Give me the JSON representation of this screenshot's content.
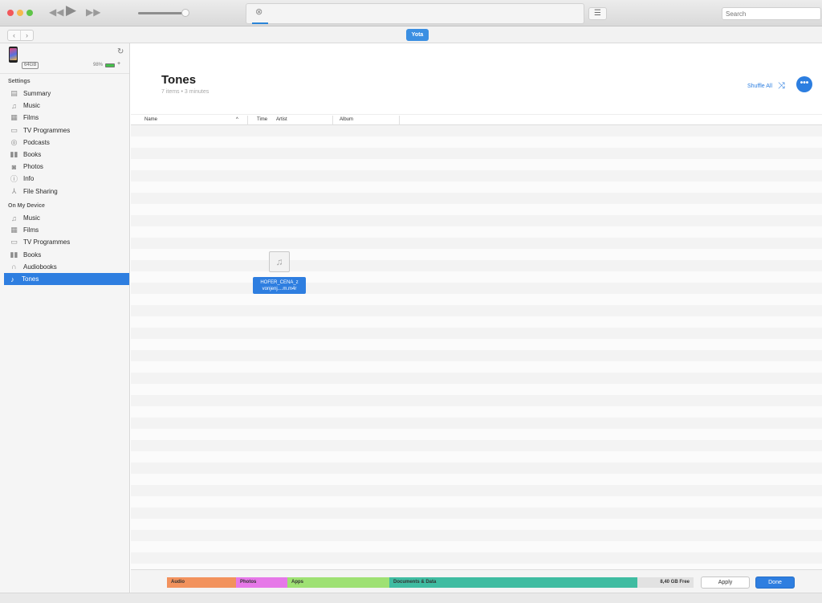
{
  "toolbar": {
    "search_placeholder": "Search",
    "lcd_icon": "close-circle-icon",
    "list_icon": "list-icon"
  },
  "navbar": {
    "back": "‹",
    "forward": "›",
    "device_name": "Yota"
  },
  "device": {
    "capacity": "64GB",
    "battery": "98%",
    "battery_level": 0.98
  },
  "sidebar": {
    "settings_title": "Settings",
    "settings_items": [
      {
        "label": "Summary",
        "icon": "summary-icon"
      },
      {
        "label": "Music",
        "icon": "music-note-icon"
      },
      {
        "label": "Films",
        "icon": "film-icon"
      },
      {
        "label": "TV Programmes",
        "icon": "tv-icon"
      },
      {
        "label": "Podcasts",
        "icon": "podcast-icon"
      },
      {
        "label": "Books",
        "icon": "books-icon"
      },
      {
        "label": "Photos",
        "icon": "camera-icon"
      },
      {
        "label": "Info",
        "icon": "info-icon"
      },
      {
        "label": "File Sharing",
        "icon": "file-sharing-icon"
      }
    ],
    "device_title": "On My Device",
    "device_items": [
      {
        "label": "Music",
        "icon": "music-note-icon"
      },
      {
        "label": "Films",
        "icon": "film-icon"
      },
      {
        "label": "TV Programmes",
        "icon": "tv-icon"
      },
      {
        "label": "Books",
        "icon": "books-icon"
      },
      {
        "label": "Audiobooks",
        "icon": "headphones-icon"
      },
      {
        "label": "Tones",
        "icon": "bell-icon",
        "active": true
      }
    ]
  },
  "main": {
    "title": "Tones",
    "subtitle": "7 items • 3 minutes",
    "shuffle_label": "Shuffle All",
    "columns": [
      "Name",
      "Time",
      "Artist",
      "Album"
    ],
    "drag_file": {
      "line1": "HOFER_CENA_z",
      "line2": "vonjenj....m.m4r"
    }
  },
  "storage": {
    "segments": [
      {
        "label": "Audio",
        "color": "#f2925d"
      },
      {
        "label": "Photos",
        "color": "#e678e8"
      },
      {
        "label": "Apps",
        "color": "#9ee173"
      },
      {
        "label": "Documents & Data",
        "color": "#3fbca1"
      }
    ],
    "free": "8,40 GB Free",
    "apply": "Apply",
    "done": "Done"
  },
  "colors": {
    "accent": "#2e7ee0"
  }
}
